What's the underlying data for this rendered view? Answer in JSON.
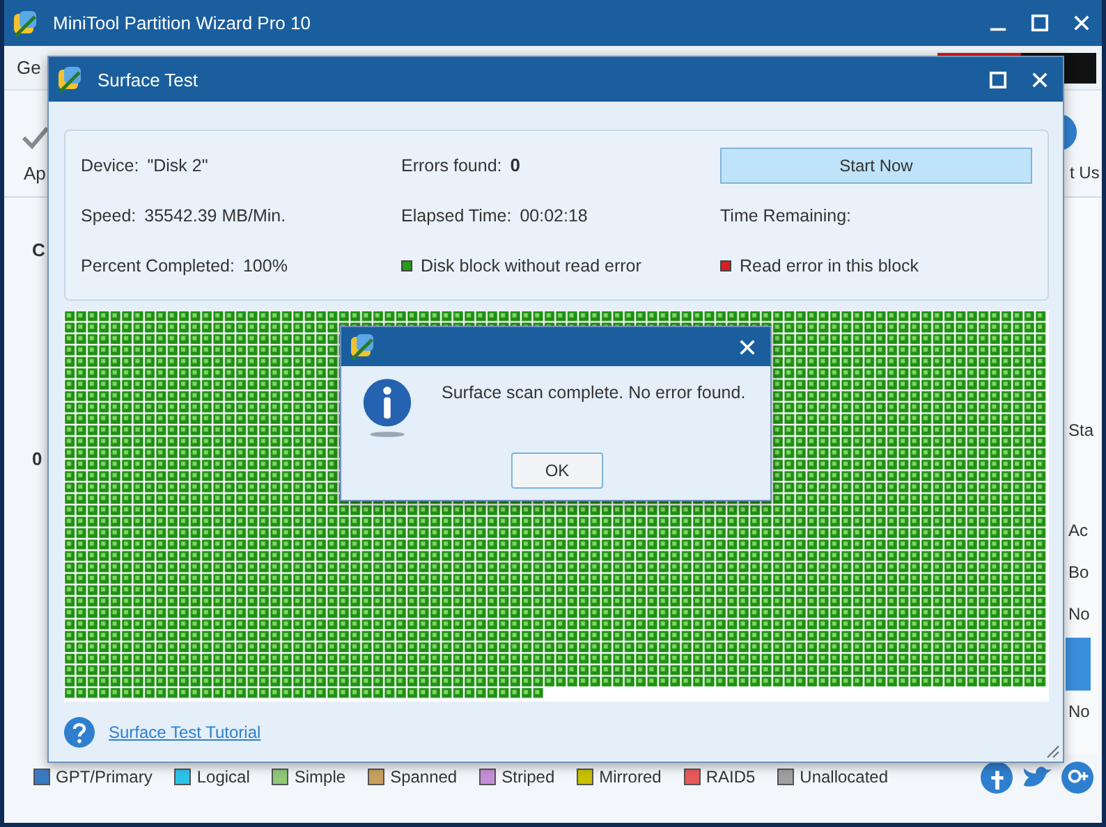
{
  "main_window": {
    "title": "MiniTool Partition Wizard Pro 10",
    "menu": [
      "Ge"
    ],
    "toolbar_left": "Ap",
    "toolbar_right": "t Us",
    "side_texts": [
      "C",
      "0"
    ],
    "right_column": [
      "Sta",
      "Ac",
      "Bo",
      "No",
      "No"
    ],
    "legend": [
      {
        "label": "GPT/Primary",
        "color": "#3a7ac0"
      },
      {
        "label": "Logical",
        "color": "#2ec3e6"
      },
      {
        "label": "Simple",
        "color": "#8fc97a"
      },
      {
        "label": "Spanned",
        "color": "#c8a060"
      },
      {
        "label": "Striped",
        "color": "#c58fd6"
      },
      {
        "label": "Mirrored",
        "color": "#c8c000"
      },
      {
        "label": "RAID5",
        "color": "#e85a5a"
      },
      {
        "label": "Unallocated",
        "color": "#a0a0a0"
      }
    ]
  },
  "dialog": {
    "title": "Surface Test",
    "fields": [
      {
        "kind": "text",
        "label": "Device:",
        "value": "\"Disk 2\""
      },
      {
        "kind": "count",
        "label": "Errors found:",
        "value": "0"
      },
      {
        "kind": "button",
        "label": "Start Now"
      },
      {
        "kind": "text",
        "label": "Speed:",
        "value": "35542.39 MB/Min."
      },
      {
        "kind": "text",
        "label": "Elapsed Time:",
        "value": "00:02:18"
      },
      {
        "kind": "text",
        "label": "Time Remaining:"
      },
      {
        "kind": "text",
        "label": "Percent Completed:",
        "value": "100%"
      },
      {
        "kind": "legend",
        "label": "Disk block without read error",
        "color": "#2a9a1a"
      },
      {
        "kind": "legend",
        "label": "Read error in this block",
        "color": "#d42020"
      }
    ],
    "tutorial_link": "Surface Test Tutorial"
  },
  "message_box": {
    "message": "Surface scan complete. No error found.",
    "button": "OK"
  }
}
